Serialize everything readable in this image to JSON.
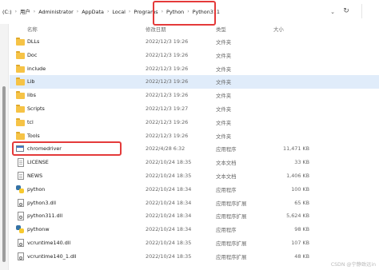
{
  "address_bar": {
    "crumbs": [
      "(C:)",
      "用户",
      "Administrator",
      "AppData",
      "Local",
      "Programs",
      "Python",
      "Python311"
    ]
  },
  "columns": {
    "name": "名称",
    "date": "修改日期",
    "type": "类型",
    "size": "大小"
  },
  "files": [
    {
      "name": "DLLs",
      "date": "2022/12/3 19:26",
      "type": "文件夹",
      "size": "",
      "icon": "folder-icon"
    },
    {
      "name": "Doc",
      "date": "2022/12/3 19:26",
      "type": "文件夹",
      "size": "",
      "icon": "folder-icon"
    },
    {
      "name": "include",
      "date": "2022/12/3 19:26",
      "type": "文件夹",
      "size": "",
      "icon": "folder-icon"
    },
    {
      "name": "Lib",
      "date": "2022/12/3 19:26",
      "type": "文件夹",
      "size": "",
      "icon": "folder-icon"
    },
    {
      "name": "libs",
      "date": "2022/12/3 19:26",
      "type": "文件夹",
      "size": "",
      "icon": "folder-icon"
    },
    {
      "name": "Scripts",
      "date": "2022/12/3 19:27",
      "type": "文件夹",
      "size": "",
      "icon": "folder-icon"
    },
    {
      "name": "tcl",
      "date": "2022/12/3 19:26",
      "type": "文件夹",
      "size": "",
      "icon": "folder-icon"
    },
    {
      "name": "Tools",
      "date": "2022/12/3 19:26",
      "type": "文件夹",
      "size": "",
      "icon": "folder-icon"
    },
    {
      "name": "chromedriver",
      "date": "2022/4/28 6:32",
      "type": "应用程序",
      "size": "11,471 KB",
      "icon": "application-icon"
    },
    {
      "name": "LICENSE",
      "date": "2022/10/24 18:35",
      "type": "文本文档",
      "size": "33 KB",
      "icon": "text-file-icon"
    },
    {
      "name": "NEWS",
      "date": "2022/10/24 18:35",
      "type": "文本文档",
      "size": "1,406 KB",
      "icon": "text-file-icon"
    },
    {
      "name": "python",
      "date": "2022/10/24 18:34",
      "type": "应用程序",
      "size": "100 KB",
      "icon": "python-icon"
    },
    {
      "name": "python3.dll",
      "date": "2022/10/24 18:34",
      "type": "应用程序扩展",
      "size": "65 KB",
      "icon": "dll-file-icon"
    },
    {
      "name": "python311.dll",
      "date": "2022/10/24 18:34",
      "type": "应用程序扩展",
      "size": "5,624 KB",
      "icon": "dll-file-icon"
    },
    {
      "name": "pythonw",
      "date": "2022/10/24 18:34",
      "type": "应用程序",
      "size": "98 KB",
      "icon": "python-icon"
    },
    {
      "name": "vcruntime140.dll",
      "date": "2022/10/24 18:35",
      "type": "应用程序扩展",
      "size": "107 KB",
      "icon": "dll-file-icon"
    },
    {
      "name": "vcruntime140_1.dll",
      "date": "2022/10/24 18:35",
      "type": "应用程序扩展",
      "size": "48 KB",
      "icon": "dll-file-icon"
    }
  ],
  "selected_row": "Lib",
  "highlight_color": "#e43a3a",
  "watermark": "CSDN @宁静致远in"
}
